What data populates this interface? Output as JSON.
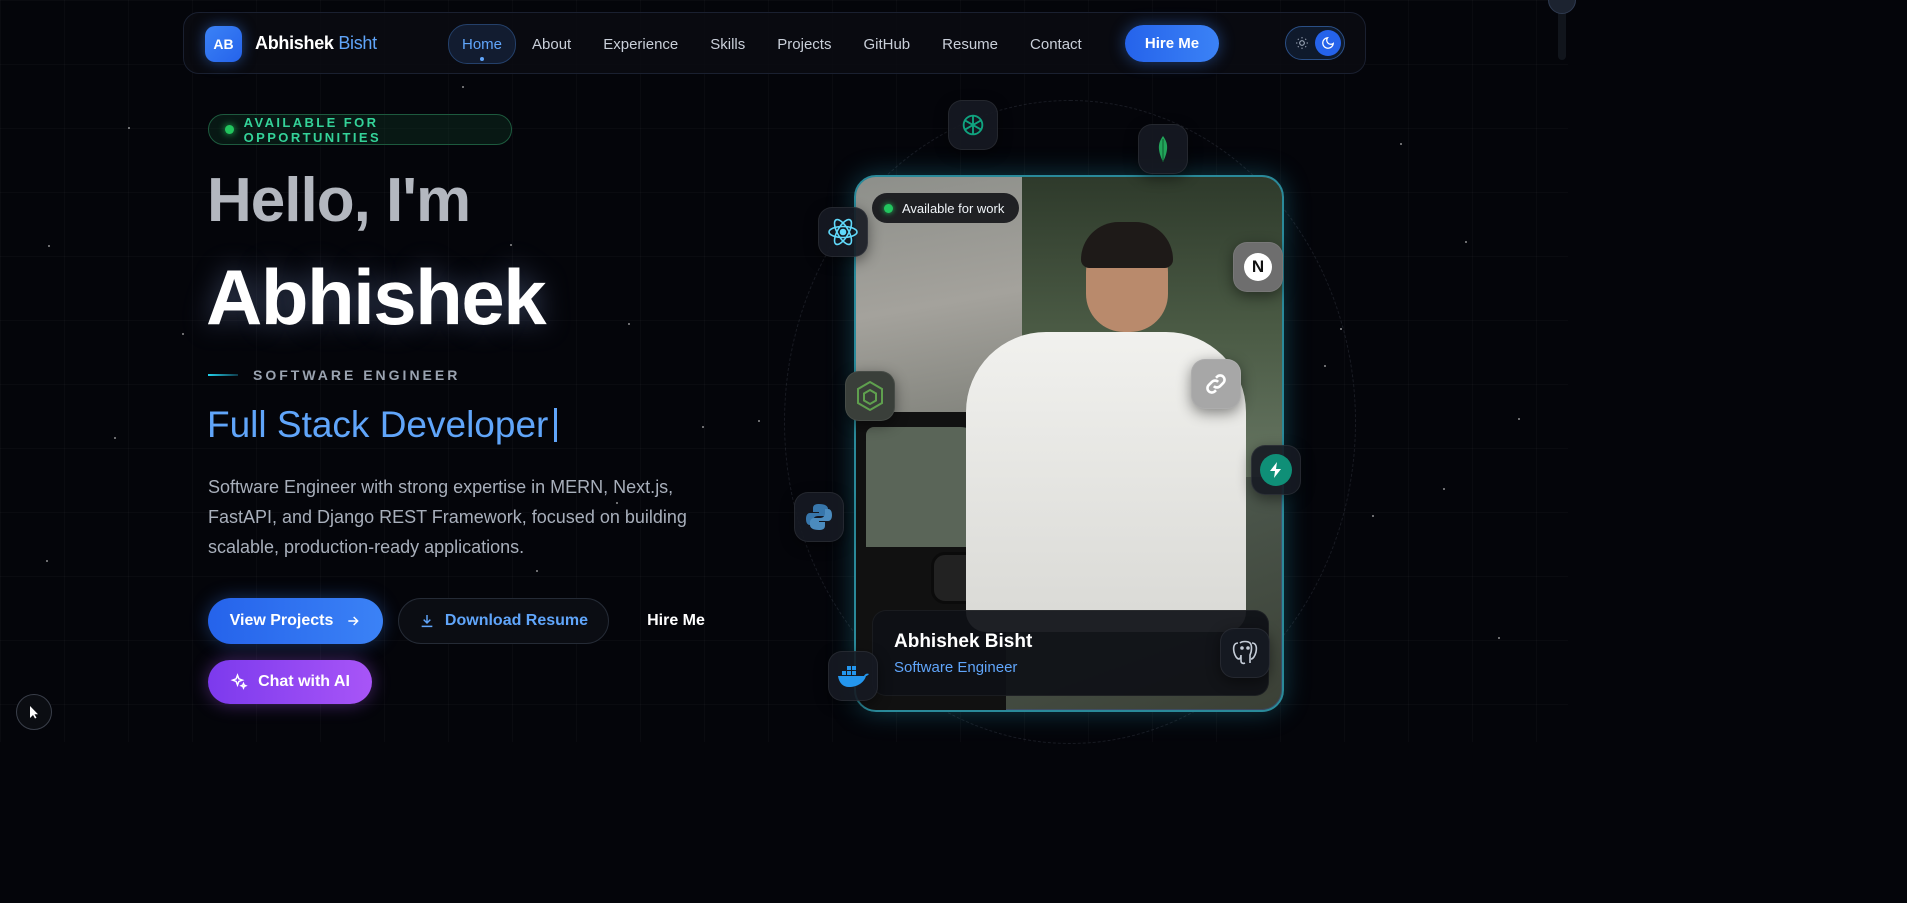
{
  "nav": {
    "logo_initials": "AB",
    "logo_first": "Abhishek",
    "logo_last": "Bisht",
    "links": [
      "Home",
      "About",
      "Experience",
      "Skills",
      "Projects",
      "GitHub",
      "Resume",
      "Contact"
    ],
    "active": "Home",
    "hire_label": "Hire Me",
    "theme_icons": [
      "sun-icon",
      "moon-icon"
    ]
  },
  "hero": {
    "badge": "AVAILABLE FOR OPPORTUNITIES",
    "greeting": "Hello, I'm",
    "name": "Abhishek",
    "role": "SOFTWARE ENGINEER",
    "typed_text": "Full Stack Developer",
    "description": "Software Engineer with strong expertise in MERN, Next.js, FastAPI, and Django REST Framework, focused on building scalable, production-ready applications.",
    "buttons": {
      "view_projects": "View Projects",
      "download_resume": "Download Resume",
      "hire_me": "Hire Me",
      "chat_ai": "Chat with AI"
    }
  },
  "profile": {
    "availability": "Available for work",
    "name": "Abhishek Bisht",
    "title": "Software Engineer",
    "tech_icons": [
      "openai-icon",
      "mongodb-icon",
      "react-icon",
      "nextjs-icon",
      "nodejs-icon",
      "link-icon",
      "supabase-icon",
      "python-icon",
      "docker-icon",
      "postgresql-icon"
    ]
  },
  "colors": {
    "accent": "#3b82f6",
    "accent_light": "#60a5fa",
    "success": "#22c55e",
    "purple": "#a855f7",
    "background": "#04050a"
  }
}
